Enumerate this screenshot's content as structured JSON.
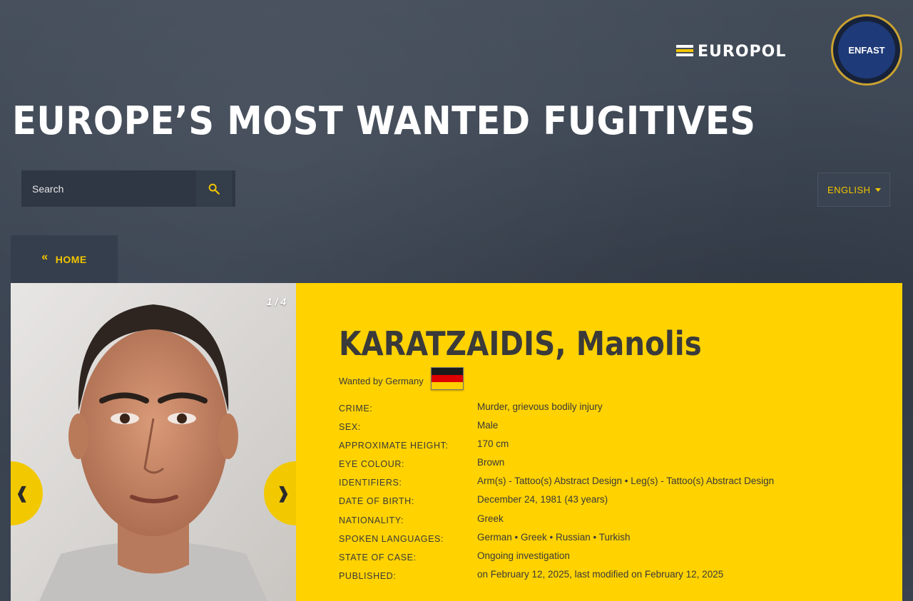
{
  "header": {
    "europol_logo_text": "EUROPOL",
    "enfast_badge_text": "ENFAST",
    "page_title": "EUROPE’S MOST WANTED FUGITIVES"
  },
  "search": {
    "placeholder": "Search",
    "icon": "search-icon"
  },
  "language": {
    "selected": "ENGLISH"
  },
  "nav": {
    "home_label": "HOME",
    "home_icon": "«"
  },
  "gallery": {
    "counter": "1 / 4",
    "prev_glyph": "❰",
    "next_glyph": "❱"
  },
  "fugitive": {
    "name": "KARATZAIDIS, Manolis",
    "wanted_by": "Wanted by Germany",
    "flag_colors": [
      "#1a1a1a",
      "#dd0000",
      "#ffce00"
    ],
    "details": [
      {
        "label": "CRIME:",
        "value": "Murder, grievous bodily injury"
      },
      {
        "label": "SEX:",
        "value": "Male"
      },
      {
        "label": "APPROXIMATE HEIGHT:",
        "value": "170 cm"
      },
      {
        "label": "EYE COLOUR:",
        "value": "Brown"
      },
      {
        "label": "IDENTIFIERS:",
        "value": "Arm(s) - Tattoo(s) Abstract Design • Leg(s) - Tattoo(s) Abstract Design"
      },
      {
        "label": "DATE OF BIRTH:",
        "value": "December 24, 1981 (43 years)"
      },
      {
        "label": "NATIONALITY:",
        "value": "Greek"
      },
      {
        "label": "SPOKEN LANGUAGES:",
        "value": "German • Greek • Russian • Turkish"
      },
      {
        "label": "STATE OF CASE:",
        "value": "Ongoing investigation"
      },
      {
        "label": "PUBLISHED:",
        "value": "on February 12, 2025, last modified on February 12, 2025"
      }
    ]
  },
  "colors": {
    "accent_yellow": "#ffd200",
    "background": "#3b4452"
  }
}
